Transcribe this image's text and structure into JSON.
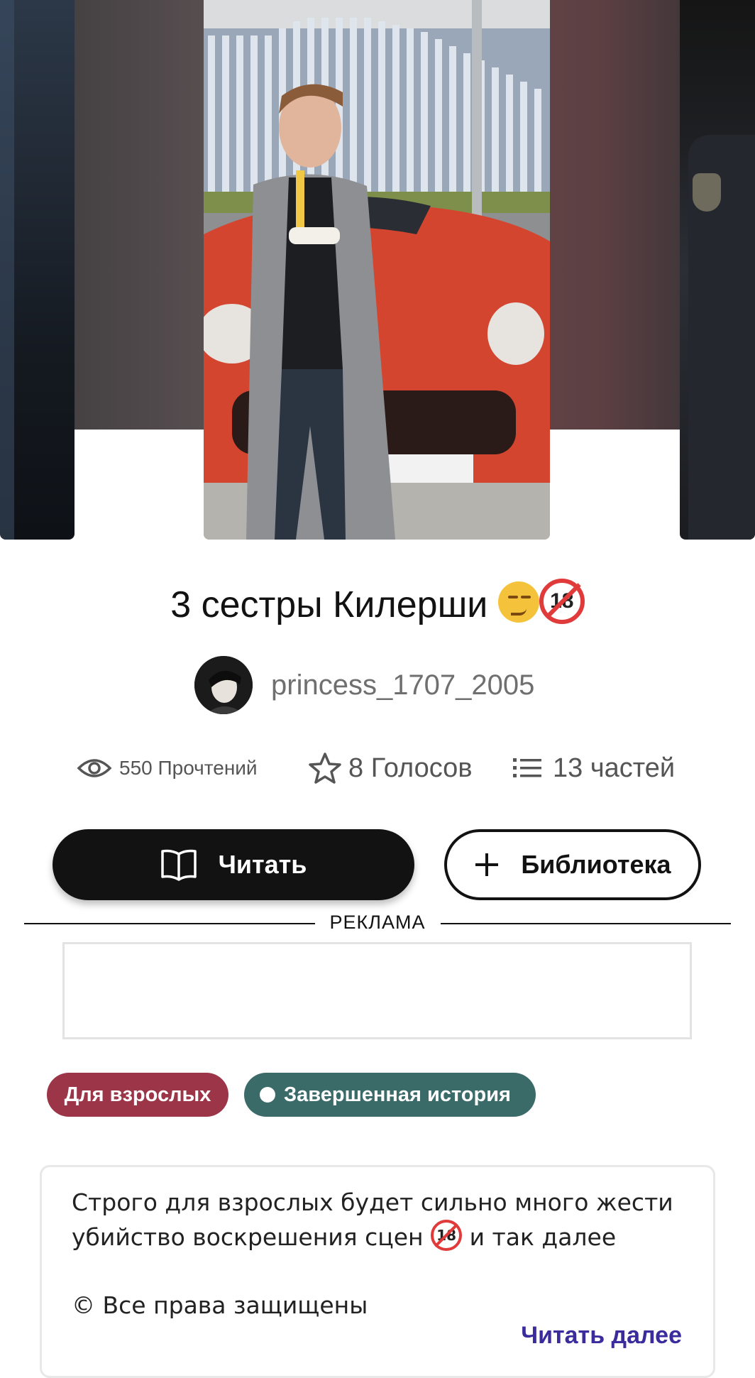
{
  "story": {
    "title": "3 сестры Килерши",
    "title_emoji": [
      "smirking-face",
      "no-one-under-eighteen"
    ],
    "author": "princess_1707_2005"
  },
  "stats": {
    "reads": "550 Прочтений",
    "votes": "8 Голосов",
    "parts": "13 частей"
  },
  "actions": {
    "read_label": "Читать",
    "library_label": "Библиотека"
  },
  "ad": {
    "label": "РЕКЛАМА"
  },
  "tags": {
    "mature": "Для взрослых",
    "complete": "Завершенная история"
  },
  "description": {
    "line1": "Строго для взрослых будет сильно много жести",
    "line2_before": "убийство воскрешения сцен",
    "line2_after": "и так далее",
    "copyright": "© Все права защищены",
    "read_more": "Читать далее"
  },
  "colors": {
    "mature_tag": "#9c3548",
    "complete_tag": "#3b6b69",
    "read_more": "#3a2c9c",
    "primary_button": "#121212"
  }
}
